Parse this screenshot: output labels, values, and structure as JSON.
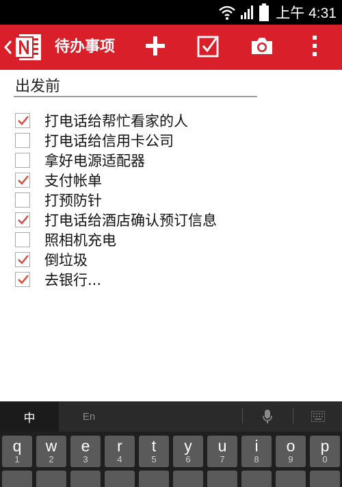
{
  "status_bar": {
    "time": "上午 4:31",
    "icons": [
      "wifi-icon",
      "signal-icon",
      "battery-icon"
    ]
  },
  "action_bar": {
    "title": "待办事项",
    "background_color": "#d81f2a",
    "icons": [
      "back-chevron-icon",
      "onenote-logo",
      "plus-icon",
      "checkbox-icon",
      "camera-icon",
      "overflow-menu-icon"
    ]
  },
  "note": {
    "title": "出发前",
    "items": [
      {
        "text": "打电话给帮忙看家的人",
        "checked": true
      },
      {
        "text": "打电话给信用卡公司",
        "checked": false
      },
      {
        "text": "拿好电源适配器",
        "checked": false
      },
      {
        "text": "支付帐单",
        "checked": true
      },
      {
        "text": "打预防针",
        "checked": false
      },
      {
        "text": "打电话给酒店确认预订信息",
        "checked": true
      },
      {
        "text": "照相机充电",
        "checked": false
      },
      {
        "text": "倒垃圾",
        "checked": true
      },
      {
        "text": "去银行...",
        "checked": true
      }
    ],
    "check_color": "#d8463c"
  },
  "keyboard": {
    "tabs": {
      "chinese": "中",
      "english": "En"
    },
    "icons": [
      "microphone-icon",
      "keyboard-grid-icon"
    ],
    "row1": [
      {
        "key": "q",
        "num": "1"
      },
      {
        "key": "w",
        "num": "2"
      },
      {
        "key": "e",
        "num": "3"
      },
      {
        "key": "r",
        "num": "4"
      },
      {
        "key": "t",
        "num": "5"
      },
      {
        "key": "y",
        "num": "6"
      },
      {
        "key": "u",
        "num": "7"
      },
      {
        "key": "i",
        "num": "8"
      },
      {
        "key": "o",
        "num": "9"
      },
      {
        "key": "p",
        "num": "0"
      }
    ]
  }
}
